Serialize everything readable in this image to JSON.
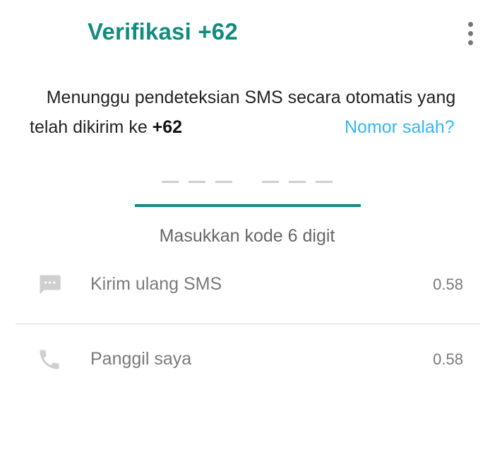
{
  "header": {
    "title": "Verifikasi +62",
    "menu_icon": "more-vert-icon"
  },
  "message": {
    "line1": "Menunggu pendeteksian SMS secara otomatis yang",
    "line2_prefix": "telah dikirim ke ",
    "phone": "+62",
    "wrong_number_link": "Nomor salah?"
  },
  "code_input": {
    "placeholder_groups": [
      "– – –",
      "– – –"
    ],
    "hint": "Masukkan kode 6 digit"
  },
  "options": [
    {
      "icon": "sms-icon",
      "label": "Kirim ulang SMS",
      "timer": "0.58"
    },
    {
      "icon": "phone-icon",
      "label": "Panggil saya",
      "timer": "0.58"
    }
  ],
  "colors": {
    "accent": "#128C7E",
    "link": "#34B7F1",
    "muted": "#7a7a7a"
  }
}
